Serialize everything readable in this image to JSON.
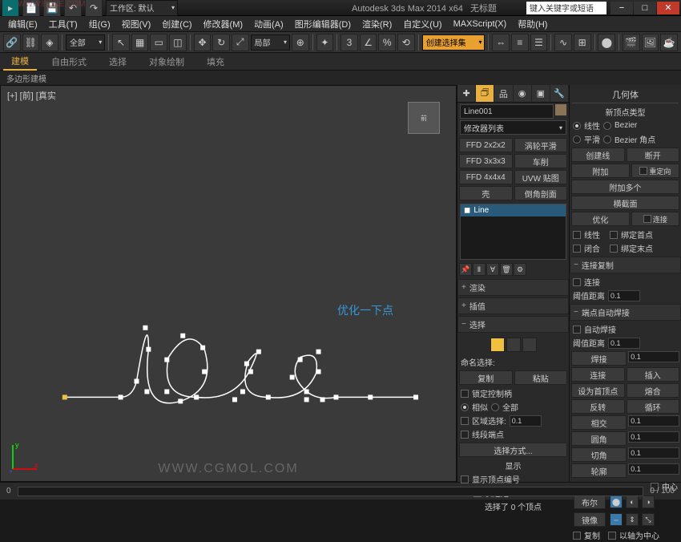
{
  "title": {
    "app": "Autodesk 3ds Max  2014 x64",
    "scene": "无标题",
    "workspace_label": "工作区: 默认",
    "search_placeholder": "键入关键字或短语"
  },
  "watermark_top": "WWW.BOXE.COM",
  "menu": [
    "编辑(E)",
    "工具(T)",
    "组(G)",
    "视图(V)",
    "创建(C)",
    "修改器(M)",
    "动画(A)",
    "图形编辑器(D)",
    "渲染(R)",
    "自定义(U)",
    "MAXScript(X)",
    "帮助(H)"
  ],
  "toolbar": {
    "snap_dd": "局部",
    "create_dd": "创建选择集"
  },
  "tabs": [
    "建模",
    "自由形式",
    "选择",
    "对象绘制",
    "填充"
  ],
  "subtab": "多边形建模",
  "viewport": {
    "label": "[+] [前] [真实",
    "annotation": "优化一下点",
    "watermark": "WWW.CGMOL.COM"
  },
  "timeline": {
    "pos": "0",
    "range": "0 / 100"
  },
  "mod_panel": {
    "object_name": "Line001",
    "dd": "修改器列表",
    "btns": [
      "FFD 2x2x2",
      "涡轮平滑",
      "FFD 3x3x3",
      "车削",
      "FFD 4x4x4",
      "UVW 贴图",
      "壳",
      "倒角剖面"
    ],
    "stack_item": "Line",
    "rollouts": {
      "render": "渲染",
      "interp": "插值",
      "select": "选择",
      "name_sel": "命名选择:",
      "copy": "复制",
      "paste": "粘贴",
      "lock_handles": "锁定控制柄",
      "similar": "相似",
      "all": "全部",
      "area_sel": "区域选择:",
      "area_val": "0.1",
      "seg_end": "线段端点",
      "sel_method": "选择方式...",
      "display": "显示",
      "show_vert_num": "显示顶点编号",
      "sel_only": "仅选定",
      "sel_status": "选择了 0 个顶点"
    }
  },
  "cmd_panel": {
    "title": "几何体",
    "new_vert": "新顶点类型",
    "linear": "线性",
    "bezier": "Bezier",
    "smooth": "平滑",
    "bezier_corner": "Bezier 角点",
    "create_line": "创建线",
    "break": "断开",
    "attach": "附加",
    "reorient": "重定向",
    "attach_mult": "附加多个",
    "cross_sect": "横截面",
    "optimize": "优化",
    "connect": "连接",
    "linear2": "线性",
    "bind_first": "绑定首点",
    "closed": "闭合",
    "bind_last": "绑定末点",
    "conn_copy": "连接复制",
    "conn": "连接",
    "thresh_dist": "阈值距离",
    "thresh_val": "0.1",
    "auto_weld": "端点自动焊接",
    "auto_weld_chk": "自动焊接",
    "weld_dist": "阈值距离",
    "weld_val": "0.1",
    "weld": "焊接",
    "weld_v": "0.1",
    "connect2": "连接",
    "insert": "插入",
    "make_first": "设为首顶点",
    "fuse": "熔合",
    "reverse": "反转",
    "cycle": "循环",
    "crossins": "相交",
    "cv1": "0.1",
    "fillet": "圆角",
    "cv2": "0.1",
    "chamfer": "切角",
    "cv3": "0.1",
    "outline": "轮廓",
    "cv4": "0.1",
    "center": "中心",
    "bool": "布尔",
    "mirror": "镜像",
    "copy2": "复制",
    "axis_center": "以轴为中心"
  }
}
